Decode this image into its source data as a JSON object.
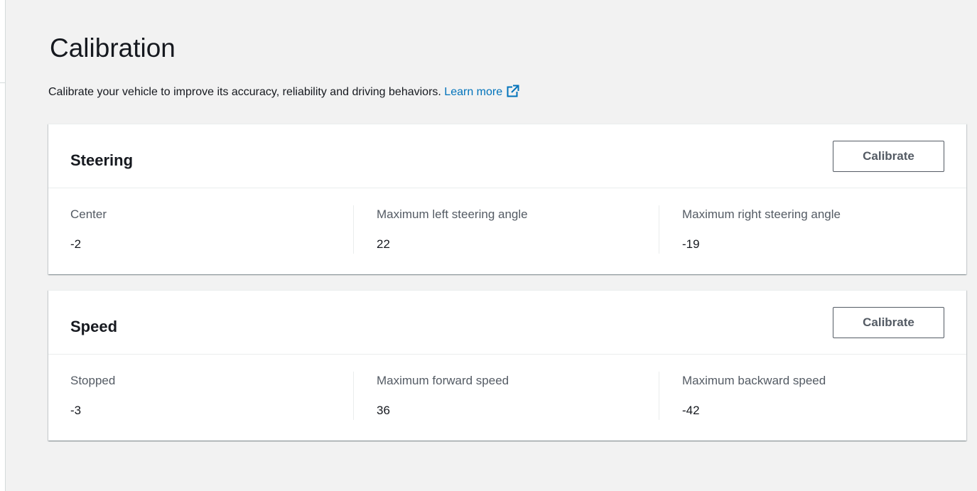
{
  "page": {
    "title": "Calibration",
    "description": "Calibrate your vehicle to improve its accuracy, reliability and driving behaviors.",
    "learn_more": "Learn more",
    "learn_more_icon": "external-link-icon"
  },
  "colors": {
    "background": "#f2f2f2",
    "card": "#ffffff",
    "link": "#0073bb",
    "text": "#16191f",
    "label": "#545b64"
  },
  "steering": {
    "title": "Steering",
    "button": "Calibrate",
    "fields": [
      {
        "label": "Center",
        "value": "-2"
      },
      {
        "label": "Maximum left steering angle",
        "value": "22"
      },
      {
        "label": "Maximum right steering angle",
        "value": "-19"
      }
    ]
  },
  "speed": {
    "title": "Speed",
    "button": "Calibrate",
    "fields": [
      {
        "label": "Stopped",
        "value": "-3"
      },
      {
        "label": "Maximum forward speed",
        "value": "36"
      },
      {
        "label": "Maximum backward speed",
        "value": "-42"
      }
    ]
  }
}
